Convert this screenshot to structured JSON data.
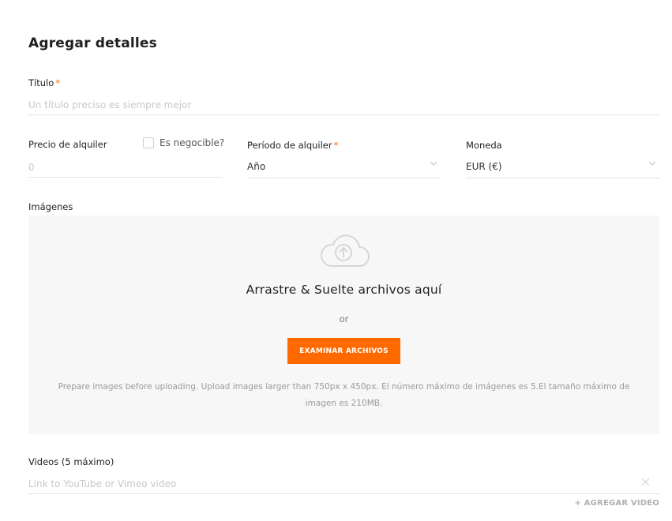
{
  "section": {
    "title": "Agregar detalles"
  },
  "title_field": {
    "label": "Título",
    "required_mark": "*",
    "placeholder": "Un título preciso es siempre mejor"
  },
  "price_field": {
    "label": "Precio de alquiler",
    "placeholder": "0"
  },
  "negotiable": {
    "label": "Es negocible?",
    "checked": false
  },
  "period_field": {
    "label": "Período de alquiler",
    "required_mark": "*",
    "value": "Año",
    "icon": "chevron-down-icon"
  },
  "currency_field": {
    "label": "Moneda",
    "value": "EUR (€)",
    "icon": "chevron-down-icon"
  },
  "images": {
    "label": "Imágenes",
    "icon": "cloud-upload-icon",
    "drop_title": "Arrastre & Suelte archivos aquí",
    "or_text": "or",
    "browse_button": "EXAMINAR ARCHIVOS",
    "note_line1": "Prepare images before uploading. Upload images larger than 750px x 450px. El número máximo de imágenes es 5.El tamaño máximo de",
    "note_line2": "imagen es 210MB."
  },
  "videos": {
    "label": "Videos (5 máximo)",
    "placeholder": "Link to YouTube or Vimeo video",
    "clear_icon": "close-icon",
    "add_button": "+ AGREGAR VIDEO"
  },
  "colors": {
    "accent": "#ff6a00",
    "dropzone_bg": "#f7f7f7",
    "divider": "#e3e3e3"
  }
}
